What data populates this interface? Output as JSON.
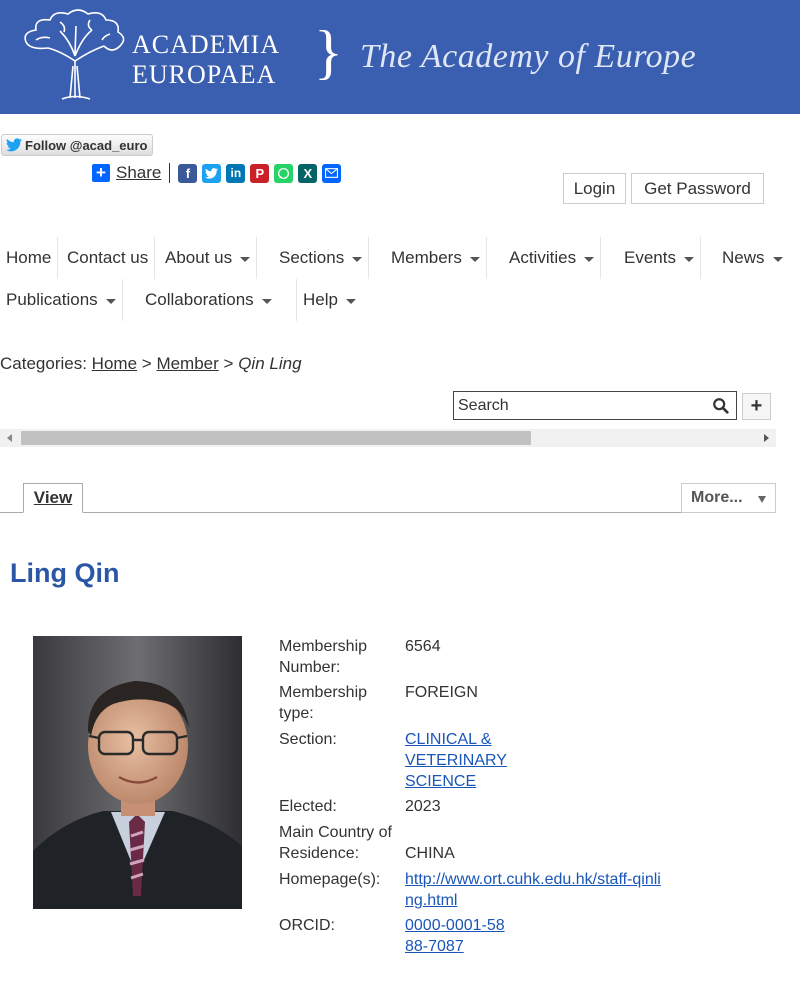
{
  "banner": {
    "logo_line1": "ACADEMIA",
    "logo_line2": "EUROPAEA",
    "brace": "}",
    "tagline": "The Academy of Europe",
    "background": "#3b5fb0"
  },
  "social": {
    "follow_label": "Follow @acad_euro",
    "share_label": "Share",
    "icons": [
      "facebook-icon",
      "twitter-icon",
      "linkedin-icon",
      "pinterest-icon",
      "whatsapp-icon",
      "xing-icon",
      "email-icon"
    ]
  },
  "account": {
    "login_label": "Login",
    "password_label": "Get Password"
  },
  "nav": {
    "items": [
      {
        "label": "Home"
      },
      {
        "label": "Contact us"
      },
      {
        "label": "About us"
      },
      {
        "label": "Sections"
      },
      {
        "label": "Members"
      },
      {
        "label": "Activities"
      },
      {
        "label": "Events"
      },
      {
        "label": "News"
      },
      {
        "label": "Publications"
      },
      {
        "label": "Collaborations"
      },
      {
        "label": "Help"
      }
    ]
  },
  "breadcrumb": {
    "prefix": "Categories:",
    "home": "Home",
    "sep1": ">",
    "member": "Member",
    "sep2": ">",
    "current": "Qin Ling"
  },
  "search": {
    "placeholder": "Search",
    "add_label": "+"
  },
  "tabs": {
    "view_label": "View",
    "more_label": "More..."
  },
  "profile": {
    "name": "Ling Qin",
    "fields": [
      {
        "label": "Membership Number:",
        "value": "6564"
      },
      {
        "label": "Membership type:",
        "value": "FOREIGN"
      },
      {
        "label": "Section:",
        "value": "CLINICAL & VETERINARY SCIENCE"
      },
      {
        "label": "Elected:",
        "value": "2023"
      },
      {
        "label": "Main Country of Residence:",
        "value": "CHINA"
      },
      {
        "label": "Homepage(s):",
        "value": "http://www.ort.cuhk.edu.hk/staff-qinling.html"
      },
      {
        "label": "ORCID:",
        "value": "0000-0001-5888-7087"
      }
    ]
  }
}
